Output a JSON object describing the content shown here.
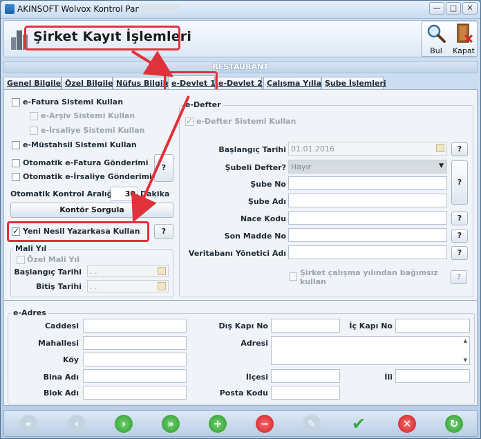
{
  "window": {
    "title": "AKINSOFT Wolvox Kontrol Paneli"
  },
  "window_controls": {
    "minimize": "—",
    "maximize": "□",
    "close": "✕"
  },
  "header": {
    "title": "Şirket Kayıt İşlemleri"
  },
  "toolbar": {
    "find_label": "Bul",
    "close_label": "Kapat"
  },
  "company_name": "RESTAURANT",
  "tabs": [
    "Genel Bilgiler",
    "Özel Bilgiler",
    "Nüfus Bilgiler",
    "e-Devlet 1",
    "e-Devlet 2",
    "Çalışma Yılları",
    "Şube İşlemleri"
  ],
  "left": {
    "efatura": "e-Fatura Sistemi Kullan",
    "earsiv": "e-Arşiv Sistemi Kullan",
    "eirsaliye": "e-İrsaliye Sistemi Kullan",
    "emustahsil": "e-Müstahsil Sistemi Kullan",
    "auto_efatura": "Otomatik e-Fatura Gönderimi",
    "auto_eirsaliye": "Otomatik e-İrsaliye Gönderimi",
    "help": "?",
    "interval_label": "Otomatik Kontrol Aralığı",
    "interval_value": "30",
    "interval_unit": "Dakika",
    "kontor_button": "Kontör Sorgula",
    "yazarkasa": "Yeni Nesil Yazarkasa Kullan",
    "yazarkasa_checked": true,
    "mali_yil_title": "Mali Yıl",
    "ozel_mali_yil": "Özel Mali Yıl",
    "baslangic_label": "Başlangıç Tarihi",
    "baslangic_value": ". .",
    "bitis_label": "Bitiş Tarihi",
    "bitis_value": ". ."
  },
  "edefter": {
    "title": "e-Defter",
    "use_label": "e-Defter Sistemi Kullan",
    "use_checked": true,
    "start_label": "Başlangıç Tarihi",
    "start_value": "01.01.2016",
    "subeli_label": "Şubeli Defter?",
    "subeli_value": "Hayır",
    "sube_no_label": "Şube No",
    "sube_no_value": "",
    "sube_adi_label": "Şube Adı",
    "sube_adi_value": "",
    "nace_label": "Nace Kodu",
    "nace_value": "",
    "son_madde_label": "Son Madde No",
    "son_madde_value": "",
    "vt_label": "Veritabanı Yönetici Adı",
    "vt_value": "",
    "bagimsiz_label": "Şirket çalışma yılından bağımsız kullan",
    "help": "?"
  },
  "eadres": {
    "title": "e-Adres",
    "caddesi": "Caddesi",
    "mahallesi": "Mahallesi",
    "koy": "Köy",
    "bina_adi": "Bina Adı",
    "blok_adi": "Blok Adı",
    "dis_kapi": "Dış Kapı No",
    "ic_kapi": "İç Kapı No",
    "adresi": "Adresi",
    "ilcesi": "İlçesi",
    "posta_kodu": "Posta Kodu",
    "ili": "İli"
  },
  "icons": {
    "nav": [
      "first-icon",
      "prev-icon",
      "next-icon",
      "last-icon",
      "add-icon",
      "delete-icon",
      "edit-icon",
      "save-icon",
      "cancel-icon",
      "refresh-icon"
    ]
  },
  "colors": {
    "highlight": "#e0323b",
    "accent_green": "#3aa83a",
    "accent_red": "#d7262d"
  }
}
